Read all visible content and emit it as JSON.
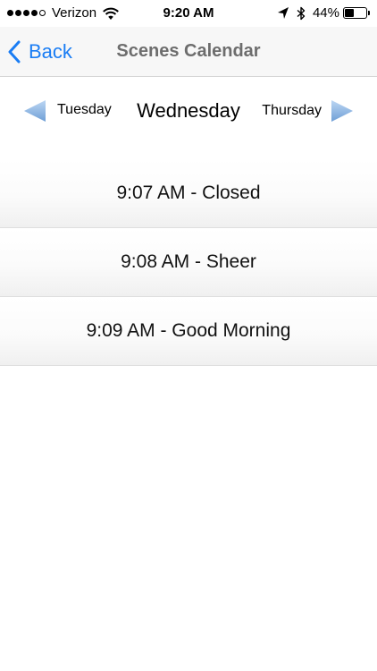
{
  "status_bar": {
    "carrier": "Verizon",
    "time": "9:20 AM",
    "battery_percent": "44%",
    "battery_level": 0.44,
    "signal_bars_filled": 4,
    "signal_bars_total": 5,
    "icons": [
      "wifi-icon",
      "location-arrow-icon",
      "bluetooth-icon",
      "battery-icon"
    ]
  },
  "nav": {
    "back_label": "Back",
    "title": "Scenes Calendar",
    "accent_color": "#1a7df4"
  },
  "day_selector": {
    "previous_day": "Tuesday",
    "current_day": "Wednesday",
    "next_day": "Thursday",
    "arrow_color": "#8fb7e6"
  },
  "scenes": [
    {
      "label": "9:07 AM - Closed"
    },
    {
      "label": "9:08 AM - Sheer"
    },
    {
      "label": "9:09 AM - Good Morning"
    }
  ]
}
